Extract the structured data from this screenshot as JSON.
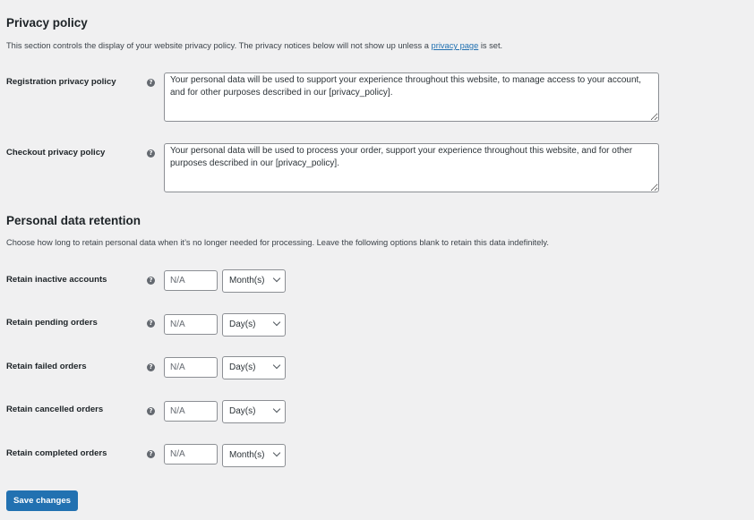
{
  "privacy_policy": {
    "title": "Privacy policy",
    "description_before": "This section controls the display of your website privacy policy. The privacy notices below will not show up unless a ",
    "description_link": "privacy page",
    "description_after": " is set.",
    "fields": [
      {
        "label": "Registration privacy policy",
        "help_icon": "help-icon",
        "value": "Your personal data will be used to support your experience throughout this website, to manage access to your account, and for other purposes described in our [privacy_policy]."
      },
      {
        "label": "Checkout privacy policy",
        "help_icon": "help-icon",
        "value": "Your personal data will be used to process your order, support your experience throughout this website, and for other purposes described in our [privacy_policy]."
      }
    ]
  },
  "retention": {
    "title": "Personal data retention",
    "description": "Choose how long to retain personal data when it’s no longer needed for processing. Leave the following options blank to retain this data indefinitely.",
    "rows": [
      {
        "label": "Retain inactive accounts",
        "placeholder": "N/A",
        "value": "",
        "unit": "Month(s)"
      },
      {
        "label": "Retain pending orders",
        "placeholder": "N/A",
        "value": "",
        "unit": "Day(s)"
      },
      {
        "label": "Retain failed orders",
        "placeholder": "N/A",
        "value": "",
        "unit": "Day(s)"
      },
      {
        "label": "Retain cancelled orders",
        "placeholder": "N/A",
        "value": "",
        "unit": "Day(s)"
      },
      {
        "label": "Retain completed orders",
        "placeholder": "N/A",
        "value": "",
        "unit": "Month(s)"
      }
    ]
  },
  "help_glyph": "?",
  "save_label": "Save changes",
  "colors": {
    "accent": "#2271b1",
    "background": "#f0f0f1",
    "text": "#1d2327"
  }
}
